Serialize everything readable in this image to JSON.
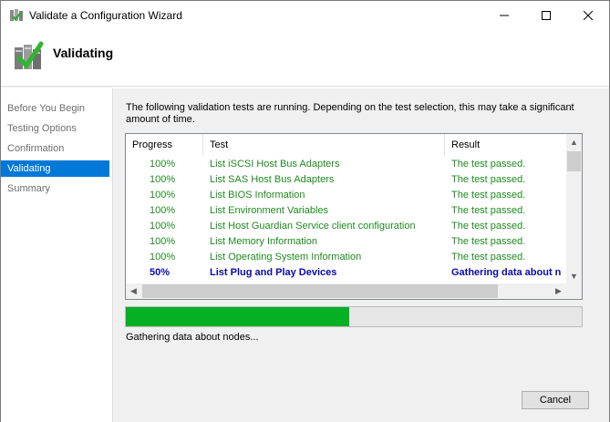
{
  "window": {
    "title": "Validate a Configuration Wizard",
    "icon": "cluster-wizard-icon"
  },
  "header": {
    "title": "Validating",
    "icon": "validate-checkmark-icon"
  },
  "nav": {
    "items": [
      {
        "label": "Before You Begin",
        "active": false
      },
      {
        "label": "Testing Options",
        "active": false
      },
      {
        "label": "Confirmation",
        "active": false
      },
      {
        "label": "Validating",
        "active": true
      },
      {
        "label": "Summary",
        "active": false
      }
    ]
  },
  "main": {
    "description": "The following validation tests are running. Depending on the test selection, this may take a significant amount of time.",
    "columns": [
      "Progress",
      "Test",
      "Result"
    ],
    "rows": [
      {
        "progress": "100%",
        "test": "List iSCSI Host Bus Adapters",
        "result": "The test passed.",
        "state": "ok"
      },
      {
        "progress": "100%",
        "test": "List SAS Host Bus Adapters",
        "result": "The test passed.",
        "state": "ok"
      },
      {
        "progress": "100%",
        "test": "List BIOS Information",
        "result": "The test passed.",
        "state": "ok"
      },
      {
        "progress": "100%",
        "test": "List Environment Variables",
        "result": "The test passed.",
        "state": "ok"
      },
      {
        "progress": "100%",
        "test": "List Host Guardian Service client configuration",
        "result": "The test passed.",
        "state": "ok"
      },
      {
        "progress": "100%",
        "test": "List Memory Information",
        "result": "The test passed.",
        "state": "ok"
      },
      {
        "progress": "100%",
        "test": "List Operating System Information",
        "result": "The test passed.",
        "state": "ok"
      },
      {
        "progress": "50%",
        "test": "List Plug and Play Devices",
        "result": "Gathering data about n",
        "state": "run"
      }
    ],
    "progress_fraction": 0.49,
    "status_text": "Gathering data about nodes...",
    "colors": {
      "passed": "#1f8a1f",
      "running": "#0a0aa8",
      "progress": "#06b025",
      "selection": "#0078d7"
    }
  },
  "footer": {
    "cancel_label": "Cancel"
  }
}
